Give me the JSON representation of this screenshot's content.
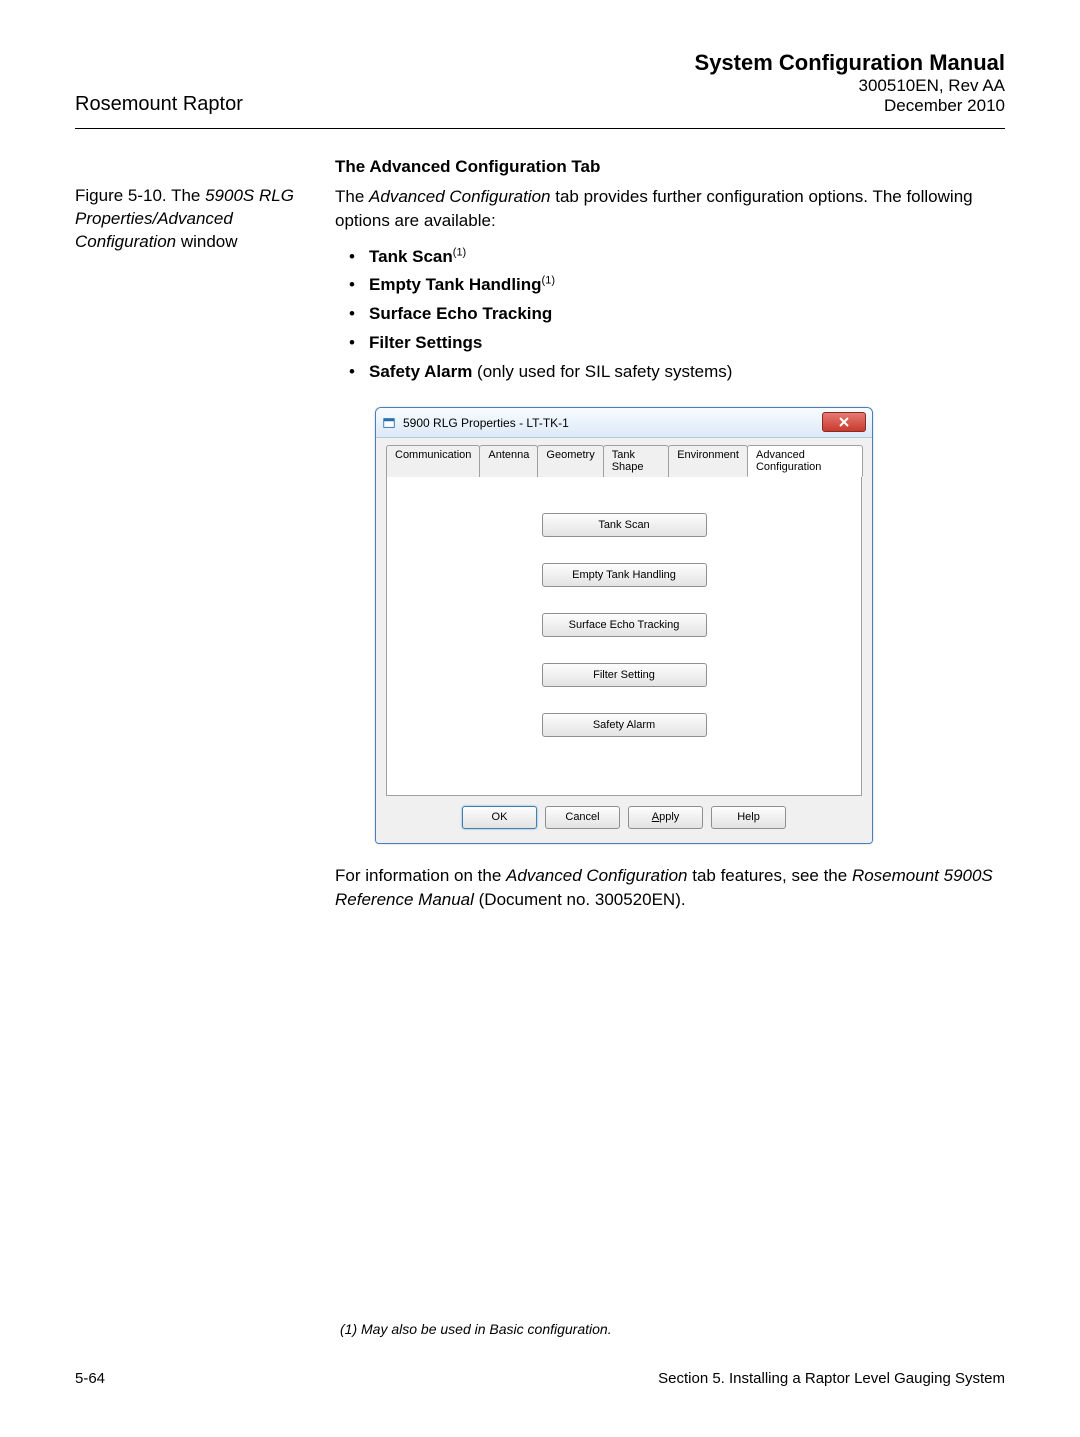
{
  "header": {
    "product": "Rosemount Raptor",
    "manual_title": "System Configuration Manual",
    "doc_number": "300510EN, Rev AA",
    "date": "December 2010"
  },
  "section": {
    "heading": "The Advanced Configuration Tab",
    "intro_prefix": "The ",
    "intro_italic": "Advanced Configuration",
    "intro_suffix": " tab provides further configuration options. The following options are available:",
    "bullets": {
      "b1": "Tank Scan",
      "b1_sup": "(1)",
      "b2": "Empty Tank Handling",
      "b2_sup": "(1)",
      "b3": "Surface Echo Tracking",
      "b4": "Filter Settings",
      "b5_bold": "Safety Alarm",
      "b5_rest": " (only used for SIL safety systems)"
    }
  },
  "figure": {
    "caption_prefix": "Figure 5-10. The ",
    "caption_italic": "5900S RLG Properties/Advanced Configuration",
    "caption_suffix": " window"
  },
  "dialog": {
    "title": "5900 RLG Properties - LT-TK-1",
    "tabs": {
      "t1": "Communication",
      "t2": "Antenna",
      "t3": "Geometry",
      "t4": "Tank Shape",
      "t5": "Environment",
      "t6": "Advanced Configuration"
    },
    "buttons": {
      "b1": "Tank Scan",
      "b2": "Empty Tank Handling",
      "b3": "Surface Echo Tracking",
      "b4": "Filter Setting",
      "b5": "Safety Alarm"
    },
    "footer": {
      "ok": "OK",
      "cancel": "Cancel",
      "apply_pre": "A",
      "apply_rest": "pply",
      "help": "Help"
    }
  },
  "after_figure": {
    "prefix": "For information on the ",
    "italic1": "Advanced Configuration",
    "mid": " tab features, see the ",
    "italic2": "Rosemount 5900S Reference Manual",
    "suffix": " (Document no. 300520EN)."
  },
  "footnote": "(1)   May also be used in Basic configuration.",
  "footer": {
    "page": "5-64",
    "section": "Section 5. Installing a Raptor Level Gauging System"
  }
}
